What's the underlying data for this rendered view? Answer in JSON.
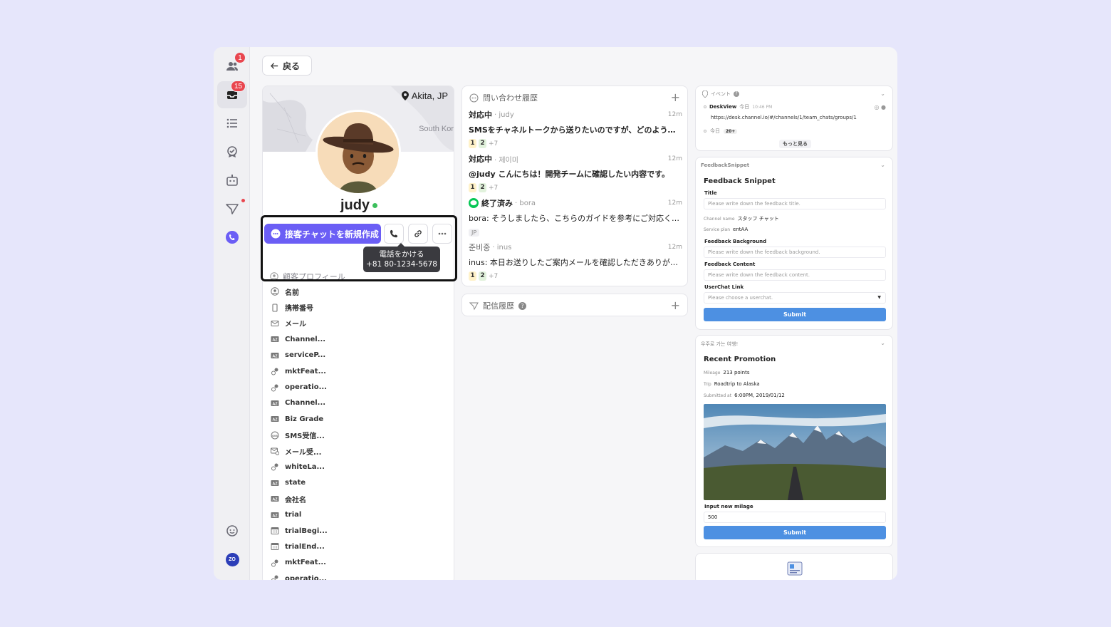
{
  "nav": {
    "people_badge": "1",
    "inbox_badge": "15",
    "avatar_initials": "ZO"
  },
  "back_label": "戻る",
  "profile": {
    "location": "Akita, JP",
    "map_label": "South Kor",
    "name": "judy",
    "new_chat_label": "接客チャットを新規作成",
    "tooltip_line1": "電話をかける",
    "tooltip_line2": "+81 80-1234-5678",
    "section_title": "顧客プロフィール",
    "attributes": [
      {
        "icon": "user-circle-icon",
        "label": "名前"
      },
      {
        "icon": "mobile-icon",
        "label": "携帯番号"
      },
      {
        "icon": "mail-icon",
        "label": "メール"
      },
      {
        "icon": "text-type-icon",
        "label": "Channel..."
      },
      {
        "icon": "text-type-icon",
        "label": "serviceP..."
      },
      {
        "icon": "bool-icon",
        "label": "mktFeat..."
      },
      {
        "icon": "bool-icon",
        "label": "operatio..."
      },
      {
        "icon": "text-type-icon",
        "label": "Channel..."
      },
      {
        "icon": "text-type-icon",
        "label": "Biz Grade"
      },
      {
        "icon": "sms-icon",
        "label": "SMS受信..."
      },
      {
        "icon": "mail-check-icon",
        "label": "メール受..."
      },
      {
        "icon": "bool-icon",
        "label": "whiteLa..."
      },
      {
        "icon": "text-type-icon",
        "label": "state"
      },
      {
        "icon": "text-type-icon",
        "label": "会社名"
      },
      {
        "icon": "text-type-icon",
        "label": "trial"
      },
      {
        "icon": "calendar-icon",
        "label": "trialBegi..."
      },
      {
        "icon": "calendar-icon",
        "label": "trialEnd..."
      },
      {
        "icon": "bool-icon",
        "label": "mktFeat..."
      },
      {
        "icon": "bool-icon",
        "label": "operatio..."
      }
    ]
  },
  "history": {
    "title": "問い合わせ履歴",
    "items": [
      {
        "status": "対応中",
        "who": "· judy",
        "time": "12m",
        "msg": "SMSをチャネルトークから送りたいのですが、どのようにし...",
        "more": "+7"
      },
      {
        "status": "対応中",
        "who": "· 제이미",
        "time": "12m",
        "msg": "@judy こんにちは！開発チームに確認したい内容です。",
        "more": "+7"
      },
      {
        "status": "終了済み",
        "who": "· bora",
        "time": "12m",
        "msg": "bora: そうしましたら、こちらのガイドを参考にご対応くださ...",
        "tag": "JP"
      },
      {
        "status": "준비중",
        "who": "· inus",
        "time": "12m",
        "msg": "inus: 本日お送りしたご案内メールを確認しただきありがとう...",
        "more": "+7"
      }
    ],
    "chip1": "1",
    "chip2": "2"
  },
  "campaign": {
    "title": "配信履歴"
  },
  "events": {
    "title": "イベント",
    "event_name": "DeskView",
    "event_day": "今日",
    "event_time": "10:46 PM",
    "event_url": "https://desk.channel.io/#/channels/1/team_chats/groups/1",
    "today_label": "今日",
    "today_count": "20+",
    "more_label": "もっと見る"
  },
  "feedback": {
    "app_name": "FeedbackSnippet",
    "heading": "Feedback Snippet",
    "title_label": "Title",
    "title_placeholder": "Please write down the feedback title.",
    "channel_key": "Channel name",
    "channel_val": "スタッフ チャット",
    "plan_key": "Service plan",
    "plan_val": "entAA",
    "bg_label": "Feedback Background",
    "bg_placeholder": "Please write down the feedback background.",
    "content_label": "Feedback Content",
    "content_placeholder": "Please write down the feedback content.",
    "link_label": "UserChat Link",
    "link_placeholder": "Please choose a userchat.",
    "submit": "Submit"
  },
  "promo": {
    "app_name": "우주로 가는 여행!",
    "heading": "Recent Promotion",
    "mileage_key": "Mileage",
    "mileage_val": "213 points",
    "trip_key": "Trip",
    "trip_val": "Roadtrip to Alaska",
    "submitted_key": "Submitted at",
    "submitted_val": "6:00PM, 2019/01/12",
    "input_label": "Input new milage",
    "input_value": "500",
    "submit": "Submit"
  },
  "colors": {
    "accent": "#6b5ef5",
    "submit": "#4d90e2",
    "badge": "#e9464f",
    "online": "#3cbf5c"
  }
}
